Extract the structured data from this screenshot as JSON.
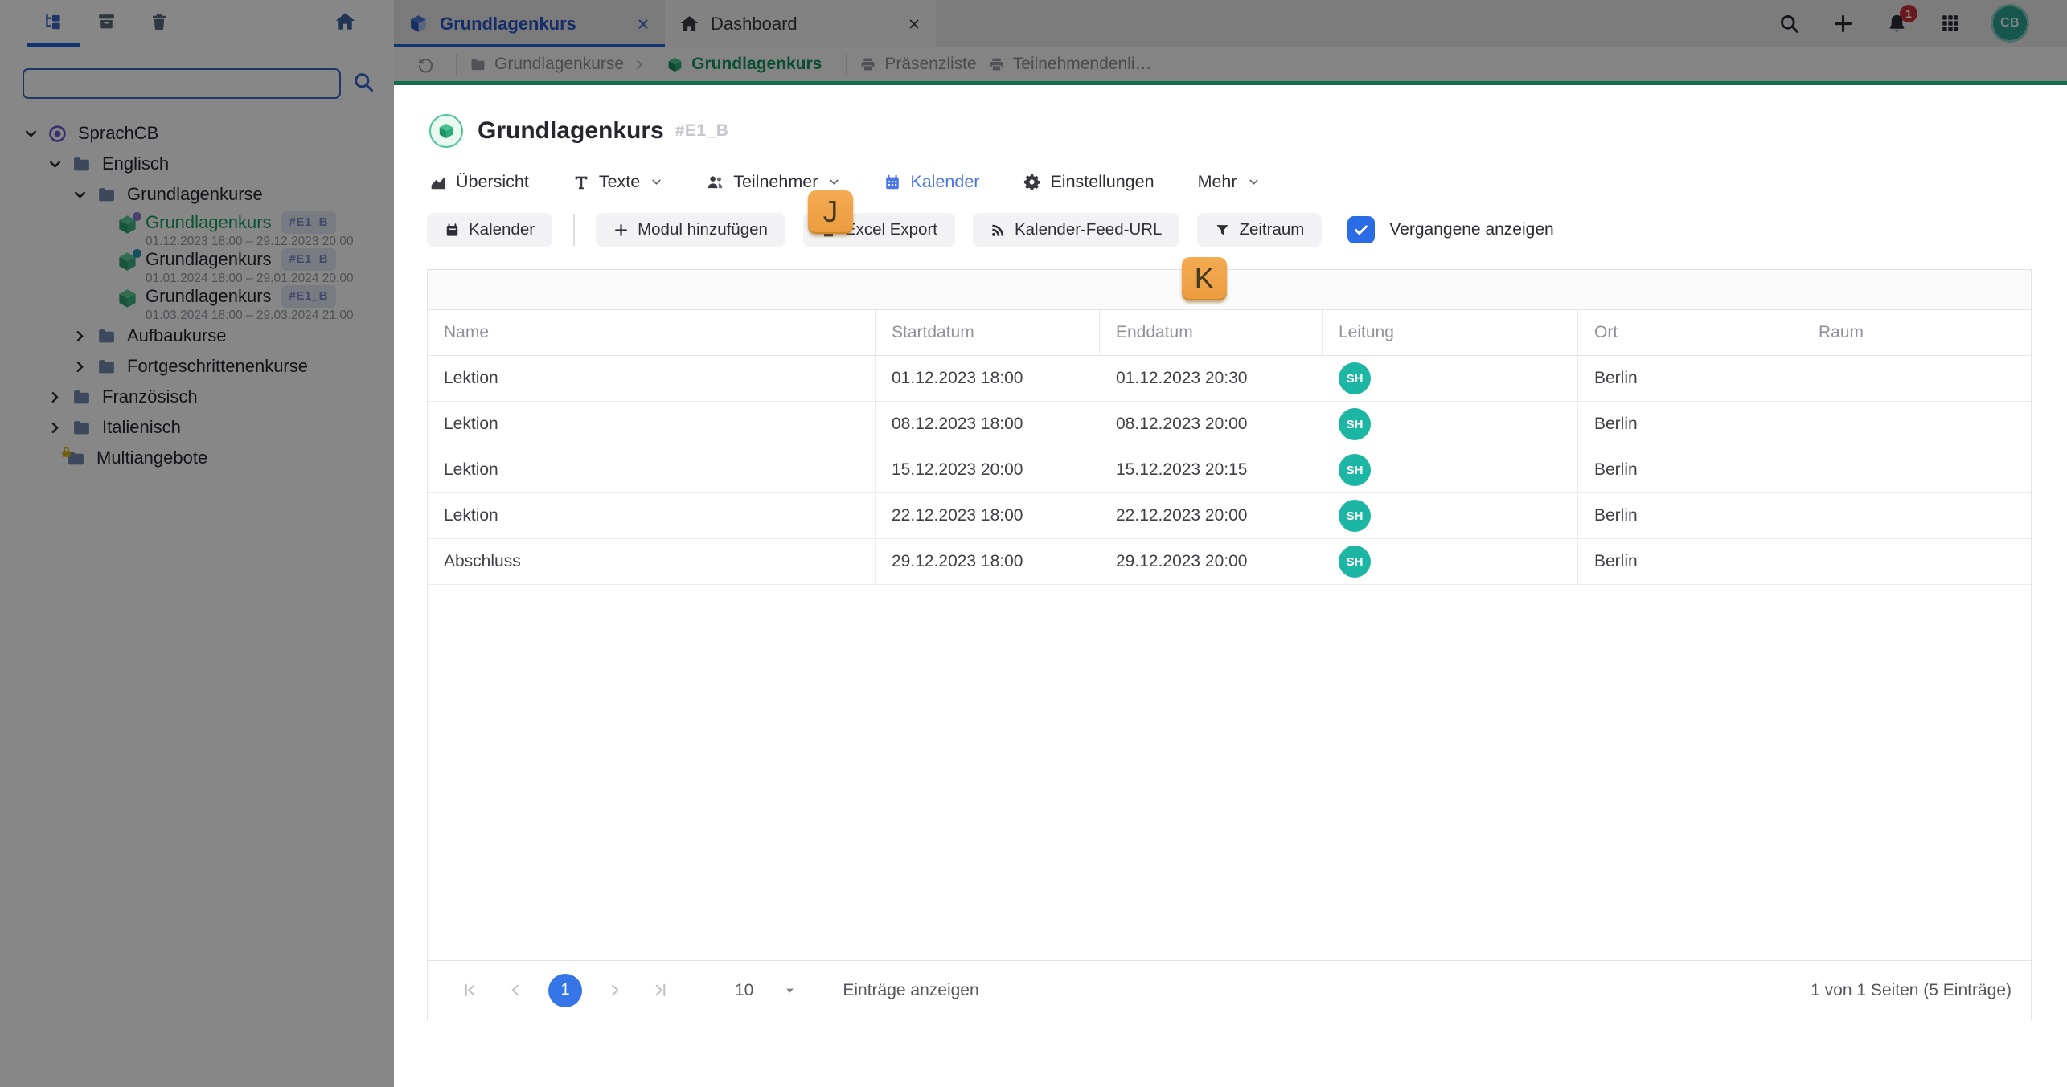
{
  "hints": {
    "j": "J",
    "k": "K"
  },
  "sidebar": {
    "search": {
      "value": "",
      "placeholder": ""
    },
    "tree": [
      {
        "label": "SprachCB"
      },
      {
        "label": "Englisch"
      },
      {
        "label": "Grundlagenkurse"
      },
      {
        "label": "Grundlagenkurs",
        "badge": "#E1_B",
        "sub": "01.12.2023 18:00 – 29.12.2023 20:00"
      },
      {
        "label": "Grundlagenkurs",
        "badge": "#E1_B",
        "sub": "01.01.2024 18:00 – 29.01.2024 20:00"
      },
      {
        "label": "Grundlagenkurs",
        "badge": "#E1_B",
        "sub": "01.03.2024 18:00 – 29.03.2024 21:00"
      },
      {
        "label": "Aufbaukurse"
      },
      {
        "label": "Fortgeschrittenenkurse"
      },
      {
        "label": "Französisch"
      },
      {
        "label": "Italienisch"
      },
      {
        "label": "Multiangebote"
      }
    ]
  },
  "window_tabs": [
    {
      "label": "Grundlagenkurs"
    },
    {
      "label": "Dashboard"
    }
  ],
  "topbar_right": {
    "bell_badge": "1",
    "avatar": "CB"
  },
  "breadcrumb": {
    "items": [
      {
        "label": "Grundlagenkurse"
      },
      {
        "label": "Grundlagenkurs"
      },
      {
        "label": "Präsenzliste"
      },
      {
        "label": "Teilnehmendenli…"
      }
    ]
  },
  "page": {
    "title": "Grundlagenkurs",
    "code": "#E1_B"
  },
  "course_tabs": [
    {
      "label": "Übersicht"
    },
    {
      "label": "Texte"
    },
    {
      "label": "Teilnehmer"
    },
    {
      "label": "Kalender"
    },
    {
      "label": "Einstellungen"
    },
    {
      "label": "Mehr"
    }
  ],
  "actions": {
    "buttons": [
      {
        "label": "Kalender"
      },
      {
        "label": "Modul hinzufügen"
      },
      {
        "label": "Excel Export"
      },
      {
        "label": "Kalender-Feed-URL"
      },
      {
        "label": "Zeitraum"
      }
    ],
    "checkbox_label": "Vergangene anzeigen",
    "checkbox_checked": true
  },
  "table": {
    "columns": [
      "Name",
      "Startdatum",
      "Enddatum",
      "Leitung",
      "Ort",
      "Raum"
    ],
    "rows": [
      {
        "name": "Lektion",
        "start": "01.12.2023 18:00",
        "end": "01.12.2023 20:30",
        "leitung": "SH",
        "ort": "Berlin",
        "raum": ""
      },
      {
        "name": "Lektion",
        "start": "08.12.2023 18:00",
        "end": "08.12.2023 20:00",
        "leitung": "SH",
        "ort": "Berlin",
        "raum": ""
      },
      {
        "name": "Lektion",
        "start": "15.12.2023 20:00",
        "end": "15.12.2023 20:15",
        "leitung": "SH",
        "ort": "Berlin",
        "raum": ""
      },
      {
        "name": "Lektion",
        "start": "22.12.2023 18:00",
        "end": "22.12.2023 20:00",
        "leitung": "SH",
        "ort": "Berlin",
        "raum": ""
      },
      {
        "name": "Abschluss",
        "start": "29.12.2023 18:00",
        "end": "29.12.2023 20:00",
        "leitung": "SH",
        "ort": "Berlin",
        "raum": ""
      }
    ]
  },
  "pagination": {
    "page": "1",
    "per_page": "10",
    "label": "Einträge anzeigen",
    "summary": "1 von 1 Seiten (5 Einträge)"
  },
  "colors": {
    "accent_blue": "#2f6fe4",
    "active_tab_blue": "#4b76e8",
    "brand_green": "#16a065",
    "content_topline_green": "#0f6f4b",
    "avatar_teal": "#1db6a4",
    "hint_orange": "#efa246",
    "notification_red": "#c7323c"
  }
}
